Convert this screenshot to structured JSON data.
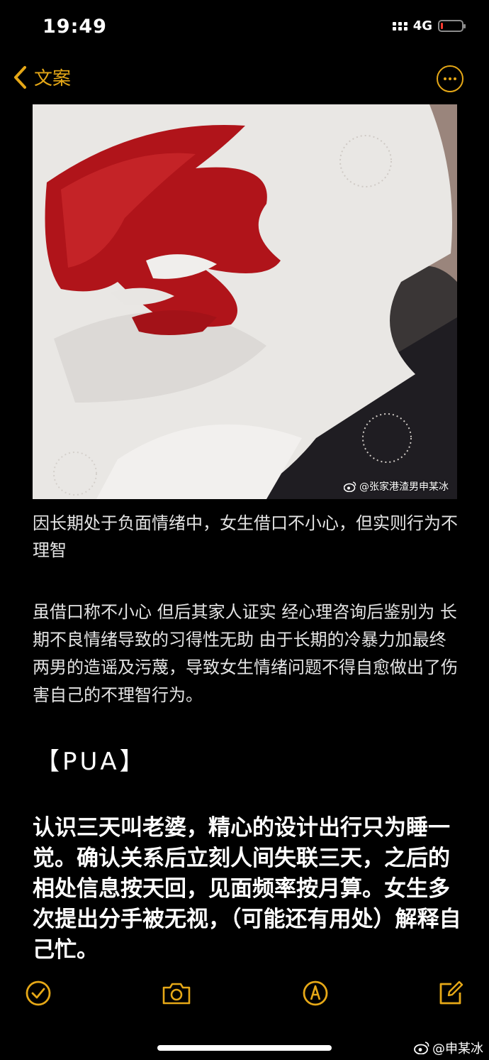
{
  "status_bar": {
    "time": "19:49",
    "network": "4G",
    "battery_level": 0.12
  },
  "nav": {
    "back_label": "文案"
  },
  "image": {
    "watermark": "@张家港渣男申某冰"
  },
  "content": {
    "caption": "因长期处于负面情绪中，女生借口不小心，但实则行为不理智",
    "paragraph2": " 虽借口称不小心 但后其家人证实 经心理咨询后鉴别为 长期不良情绪导致的习得性无助 由于长期的冷暴力加最终两男的造谣及污蔑，导致女生情绪问题不得自愈做出了伤害自己的不理智行为。",
    "section_heading": "【PUA】",
    "paragraph3": "认识三天叫老婆，精心的设计出行只为睡一觉。确认关系后立刻人间失联三天，之后的相处信息按天回，见面频率按月算。女生多次提出分手被无视，（可能还有用处）解释自己忙。"
  },
  "footer": {
    "watermark": "@申某冰"
  },
  "colors": {
    "accent": "#e6a817",
    "background": "#000000",
    "battery_low": "#ff3b30"
  }
}
